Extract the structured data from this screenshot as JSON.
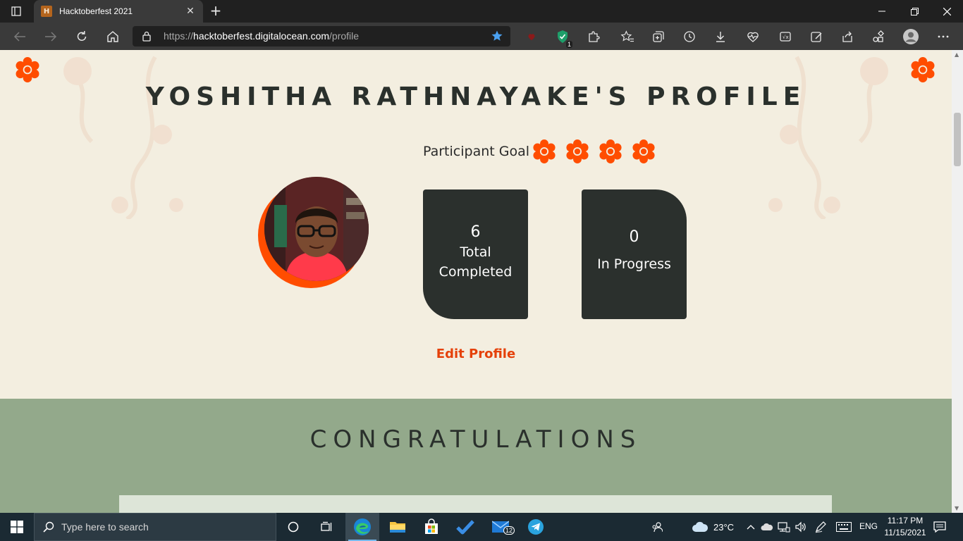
{
  "browser": {
    "tab": {
      "title": "Hacktoberfest 2021"
    },
    "new_tab_symbol": "+",
    "address": {
      "scheme": "https://",
      "host": "hacktoberfest.digitalocean.com",
      "path": "/profile"
    },
    "extension_badge": "1"
  },
  "page": {
    "profile_title": "YOSHITHA RATHNAYAKE'S PROFILE",
    "goal_label": "Participant Goal",
    "goal_flowers": 4,
    "stats": {
      "completed": {
        "value": "6",
        "label_line1": "Total",
        "label_line2": "Completed"
      },
      "in_progress": {
        "value": "0",
        "label": "In Progress"
      }
    },
    "edit_profile": "Edit Profile",
    "congrats_title": "CONGRATULATIONS"
  },
  "colors": {
    "accent_orange": "#ff4d00",
    "card_bg": "#2b302d",
    "page_bg": "#f3eee0",
    "congrats_bg": "#93a98b",
    "link": "#e5410a"
  },
  "taskbar": {
    "search_placeholder": "Type here to search",
    "mail_badge": "12",
    "weather_temp": "23°C",
    "language": "ENG",
    "time": "11:17 PM",
    "date": "11/15/2021"
  }
}
